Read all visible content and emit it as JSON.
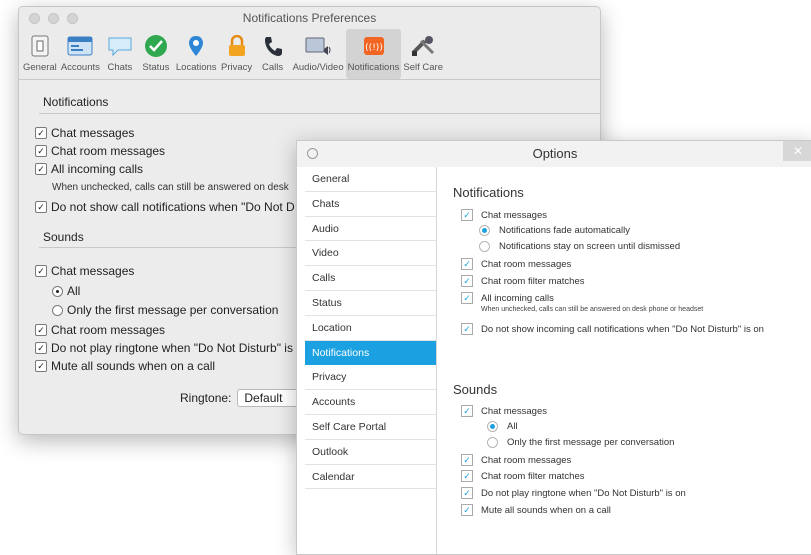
{
  "mac": {
    "title": "Notifications Preferences",
    "toolbar": [
      {
        "label": "General",
        "icon": "switch-icon"
      },
      {
        "label": "Accounts",
        "icon": "accounts-icon"
      },
      {
        "label": "Chats",
        "icon": "chat-bubble-icon"
      },
      {
        "label": "Status",
        "icon": "status-check-icon"
      },
      {
        "label": "Locations",
        "icon": "location-pin-icon"
      },
      {
        "label": "Privacy",
        "icon": "lock-icon"
      },
      {
        "label": "Calls",
        "icon": "phone-icon"
      },
      {
        "label": "Audio/Video",
        "icon": "audio-video-icon"
      },
      {
        "label": "Notifications",
        "icon": "notifications-icon",
        "active": true
      },
      {
        "label": "Self Care",
        "icon": "tools-icon"
      }
    ],
    "notifications_header": "Notifications",
    "chat_messages": "Chat messages",
    "chat_room_messages": "Chat room messages",
    "all_incoming_calls": "All incoming calls",
    "unchecked_note": "When unchecked, calls can still be answered on desk",
    "do_not_show": "Do not show call notifications when \"Do Not D",
    "sounds_header": "Sounds",
    "sounds_chat_messages": "Chat messages",
    "radio_all": "All",
    "radio_first": "Only the first message per conversation",
    "sounds_chat_room": "Chat room messages",
    "do_not_play": "Do not play ringtone when \"Do Not Disturb\" is",
    "mute_all": "Mute all sounds when on a call",
    "ringtone_label": "Ringtone:",
    "ringtone_value": "Default"
  },
  "win": {
    "title": "Options",
    "close": "✕",
    "nav": [
      "General",
      "Chats",
      "Audio",
      "Video",
      "Calls",
      "Status",
      "Location",
      "Notifications",
      "Privacy",
      "Accounts",
      "Self Care Portal",
      "Outlook",
      "Calendar"
    ],
    "selected_nav": "Notifications",
    "notifications_header": "Notifications",
    "chat_messages": "Chat messages",
    "fade_auto": "Notifications fade automatically",
    "stay_on": "Notifications stay on screen until dismissed",
    "chat_room_messages": "Chat room messages",
    "chat_room_filter": "Chat room filter matches",
    "all_incoming": "All incoming calls",
    "incoming_note": "When unchecked, calls can still be answered on desk phone or headset",
    "do_not_show": "Do not show incoming call notifications when \"Do Not Disturb\" is on",
    "sounds_header": "Sounds",
    "s_chat_messages": "Chat messages",
    "s_all": "All",
    "s_first": "Only the first message per conversation",
    "s_chat_room": "Chat room messages",
    "s_chat_filter": "Chat room filter matches",
    "s_do_not_play": "Do not play ringtone when \"Do Not Disturb\" is on",
    "s_mute": "Mute all sounds when on a call"
  },
  "colors": {
    "accent": "#1ba1e2",
    "mac_active_tab": "#d3d3d3"
  }
}
